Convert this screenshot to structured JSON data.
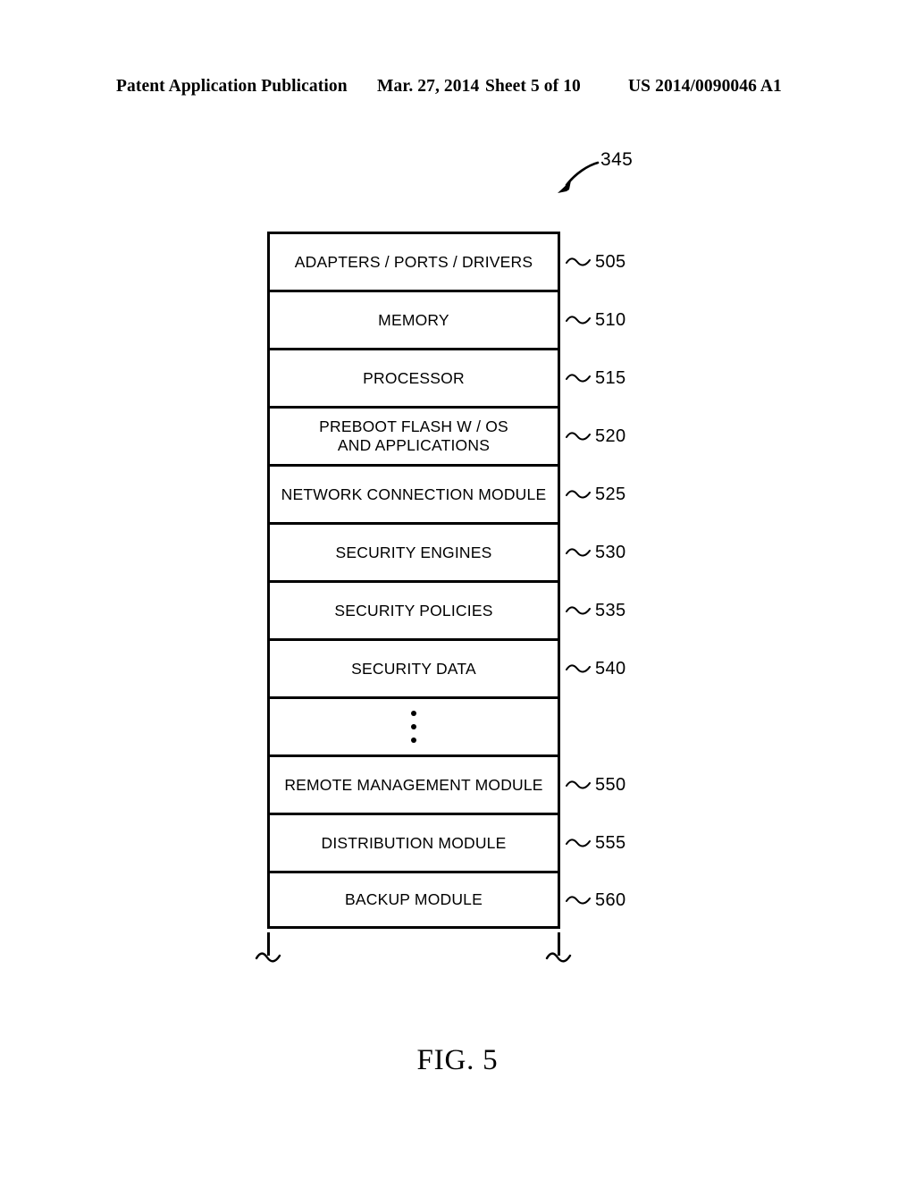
{
  "header": {
    "publication": "Patent Application Publication",
    "date": "Mar. 27, 2014",
    "sheet": "Sheet 5 of 10",
    "patent_number": "US 2014/0090046 A1"
  },
  "figure": {
    "caption": "FIG. 5",
    "assembly_ref": "345",
    "blocks": [
      {
        "label": "ADAPTERS / PORTS / DRIVERS",
        "ref": "505"
      },
      {
        "label": "MEMORY",
        "ref": "510"
      },
      {
        "label": "PROCESSOR",
        "ref": "515"
      },
      {
        "label": "PREBOOT FLASH W / OS\nAND APPLICATIONS",
        "ref": "520"
      },
      {
        "label": "NETWORK CONNECTION MODULE",
        "ref": "525"
      },
      {
        "label": "SECURITY ENGINES",
        "ref": "530"
      },
      {
        "label": "SECURITY POLICIES",
        "ref": "535"
      },
      {
        "label": "SECURITY DATA",
        "ref": "540"
      },
      {
        "label": "",
        "ref": ""
      },
      {
        "label": "REMOTE MANAGEMENT MODULE",
        "ref": "550"
      },
      {
        "label": "DISTRIBUTION MODULE",
        "ref": "555"
      },
      {
        "label": "BACKUP MODULE",
        "ref": "560"
      }
    ]
  }
}
